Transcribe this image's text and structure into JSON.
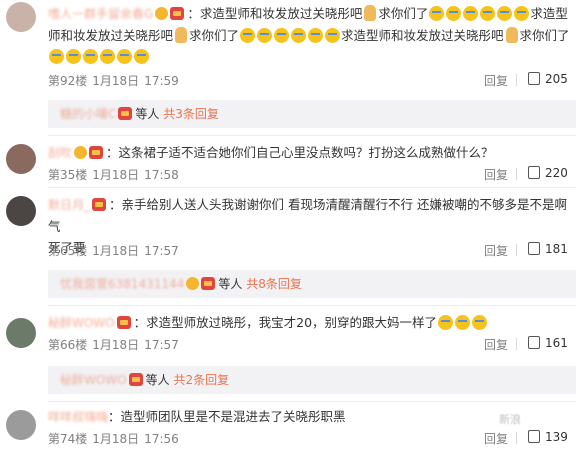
{
  "comments": [
    {
      "name": "嗜人一群手留余春G",
      "lines": [
        "求造型师和妆发放过关晓彤吧",
        "求你们了",
        "求造型",
        "师和妆发放过关晓彤吧",
        "求你们了",
        "求造型师和妆发放过关晓彤吧",
        "求你们了"
      ],
      "floor": "第92楼",
      "date": "1月18日",
      "time": "17:59",
      "reply": "回复",
      "likes": "205",
      "sub": {
        "name": "糖的小嚷C",
        "mid": "等人",
        "more": "共3条回复"
      }
    },
    {
      "name": "刮吹",
      "text": "这条裙子适不适合她你们自己心里没点数吗？打扮这么成熟做什么？",
      "floor": "第35楼",
      "date": "1月18日",
      "time": "17:58",
      "reply": "回复",
      "likes": "220"
    },
    {
      "name": "默日月_",
      "text1": "亲手给别人送人头我谢谢你们 看现场清醒清醒行不行 还嫌被嘲的不够多是不是啊 气",
      "text2": "死了要",
      "floor": "第65楼",
      "date": "1月18日",
      "time": "17:57",
      "reply": "回复",
      "likes": "181",
      "sub": {
        "name": "忧我茵萱6381431144",
        "mid": "等人",
        "more": "共8条回复"
      }
    },
    {
      "name": "秘醉WOWO",
      "text": "求造型师放过晓彤，我宝才20，别穿的跟大妈一样了",
      "floor": "第66楼",
      "date": "1月18日",
      "time": "17:57",
      "reply": "回复",
      "likes": "161",
      "sub": {
        "name": "秘醉WOWO",
        "mid": "等人",
        "more": "共2条回复"
      }
    },
    {
      "name": "咩咩叔嗨嗨",
      "text": "造型师团队里是不是混进去了关晓彤职黑",
      "floor": "第74楼",
      "date": "1月18日",
      "time": "17:56",
      "reply": "回复",
      "likes": "139"
    }
  ],
  "watermark": "新浪"
}
